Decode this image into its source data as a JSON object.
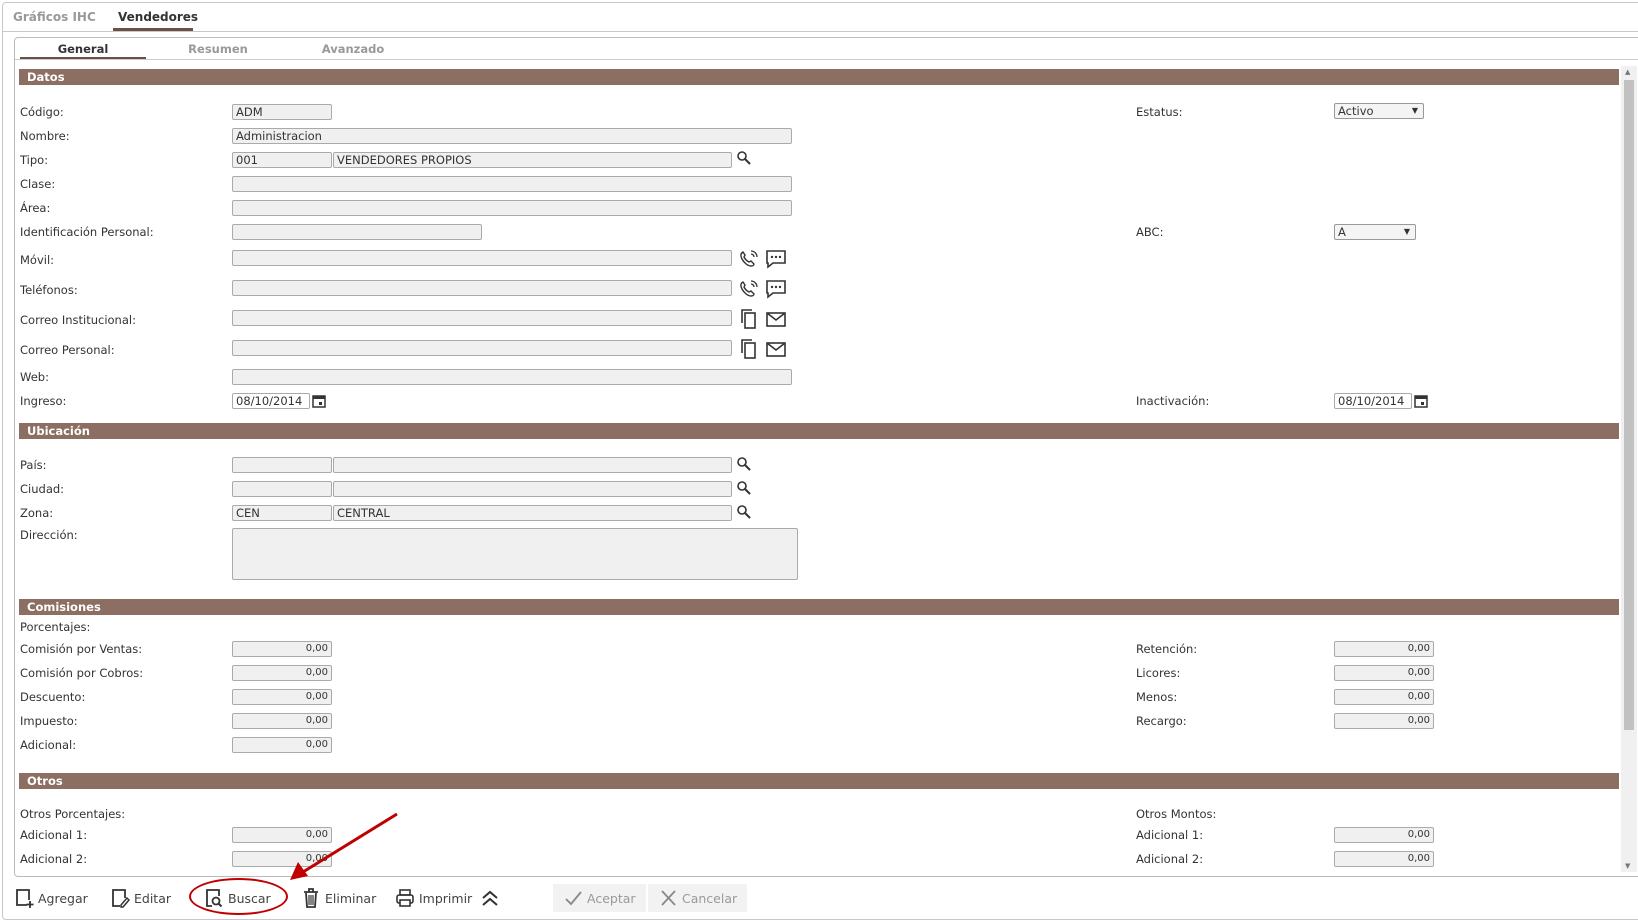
{
  "tabs": [
    {
      "label": "Gráficos IHC"
    },
    {
      "label": "Vendedores"
    }
  ],
  "subtabs": [
    {
      "label": "General"
    },
    {
      "label": "Resumen"
    },
    {
      "label": "Avanzado"
    }
  ],
  "sections": {
    "datos": "Datos",
    "ubicacion": "Ubicación",
    "comisiones": "Comisiones",
    "otros": "Otros"
  },
  "datos": {
    "codigo": {
      "label": "Código:",
      "value": "ADM"
    },
    "nombre": {
      "label": "Nombre:",
      "value": "Administracion"
    },
    "tipo": {
      "label": "Tipo:",
      "code": "001",
      "desc": "VENDEDORES PROPIOS"
    },
    "clase": {
      "label": "Clase:",
      "value": ""
    },
    "area": {
      "label": "Área:",
      "value": ""
    },
    "ident": {
      "label": "Identificación Personal:",
      "value": ""
    },
    "movil": {
      "label": "Móvil:",
      "value": ""
    },
    "telefonos": {
      "label": "Teléfonos:",
      "value": ""
    },
    "correo_inst": {
      "label": "Correo Institucional:",
      "value": ""
    },
    "correo_pers": {
      "label": "Correo Personal:",
      "value": ""
    },
    "web": {
      "label": "Web:",
      "value": ""
    },
    "ingreso": {
      "label": "Ingreso:",
      "value": "08/10/2014"
    },
    "estatus": {
      "label": "Estatus:",
      "value": "Activo"
    },
    "abc": {
      "label": "ABC:",
      "value": "A"
    },
    "inactivacion": {
      "label": "Inactivación:",
      "value": "08/10/2014"
    }
  },
  "ubicacion": {
    "pais": {
      "label": "País:",
      "code": "",
      "desc": ""
    },
    "ciudad": {
      "label": "Ciudad:",
      "code": "",
      "desc": ""
    },
    "zona": {
      "label": "Zona:",
      "code": "CEN",
      "desc": "CENTRAL"
    },
    "direccion": {
      "label": "Dirección:",
      "value": ""
    }
  },
  "comisiones": {
    "porcentajes": "Porcentajes:",
    "left": [
      {
        "label": "Comisión por Ventas:",
        "value": "0,00"
      },
      {
        "label": "Comisión por Cobros:",
        "value": "0,00"
      },
      {
        "label": "Descuento:",
        "value": "0,00"
      },
      {
        "label": "Impuesto:",
        "value": "0,00"
      },
      {
        "label": "Adicional:",
        "value": "0,00"
      }
    ],
    "right": [
      {
        "label": "Retención:",
        "value": "0,00"
      },
      {
        "label": "Licores:",
        "value": "0,00"
      },
      {
        "label": "Menos:",
        "value": "0,00"
      },
      {
        "label": "Recargo:",
        "value": "0,00"
      }
    ]
  },
  "otros": {
    "porcentajes": "Otros Porcentajes:",
    "montos": "Otros Montos:",
    "left": [
      {
        "label": "Adicional 1:",
        "value": "0,00"
      },
      {
        "label": "Adicional 2:",
        "value": "0,00"
      }
    ],
    "right": [
      {
        "label": "Adicional 1:",
        "value": "0,00"
      },
      {
        "label": "Adicional 2:",
        "value": "0,00"
      }
    ]
  },
  "toolbar": {
    "agregar": "Agregar",
    "editar": "Editar",
    "buscar": "Buscar",
    "eliminar": "Eliminar",
    "imprimir": "Imprimir",
    "aceptar": "Aceptar",
    "cancelar": "Cancelar"
  },
  "colors": {
    "section": "#8c6e62",
    "annotation": "#c00000"
  }
}
